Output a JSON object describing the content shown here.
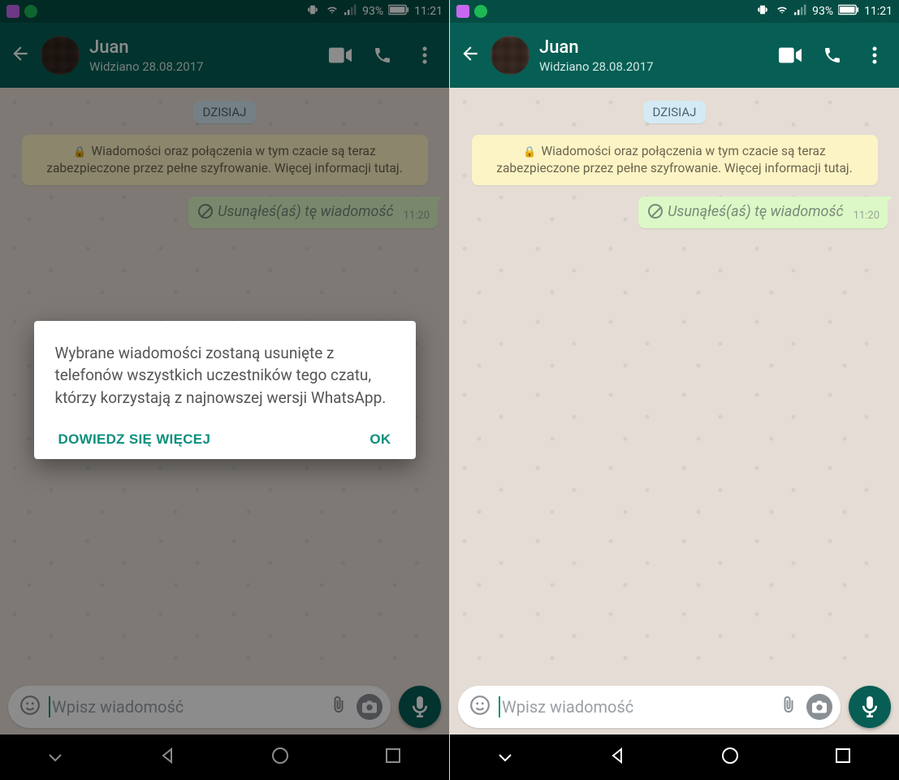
{
  "statusbar": {
    "battery_pct": "93%",
    "time": "11:21"
  },
  "header": {
    "contact_name": "Juan",
    "last_seen": "Widziano 28.08.2017"
  },
  "chat": {
    "date_label": "DZISIAJ",
    "encryption_notice": "Wiadomości oraz połączenia w tym czacie są teraz zabezpieczone przez pełne szyfrowanie. Więcej informacji tutaj.",
    "deleted_message": "Usunąłeś(aś) tę wiadomość",
    "deleted_time": "11:20"
  },
  "input": {
    "placeholder": "Wpisz wiadomość"
  },
  "dialog": {
    "body": "Wybrane wiadomości zostaną usunięte z telefonów wszystkich uczestników tego czatu, którzy korzystają z najnowszej wersji WhatsApp.",
    "learn_more": "DOWIEDZ SIĘ WIĘCEJ",
    "ok": "OK"
  }
}
